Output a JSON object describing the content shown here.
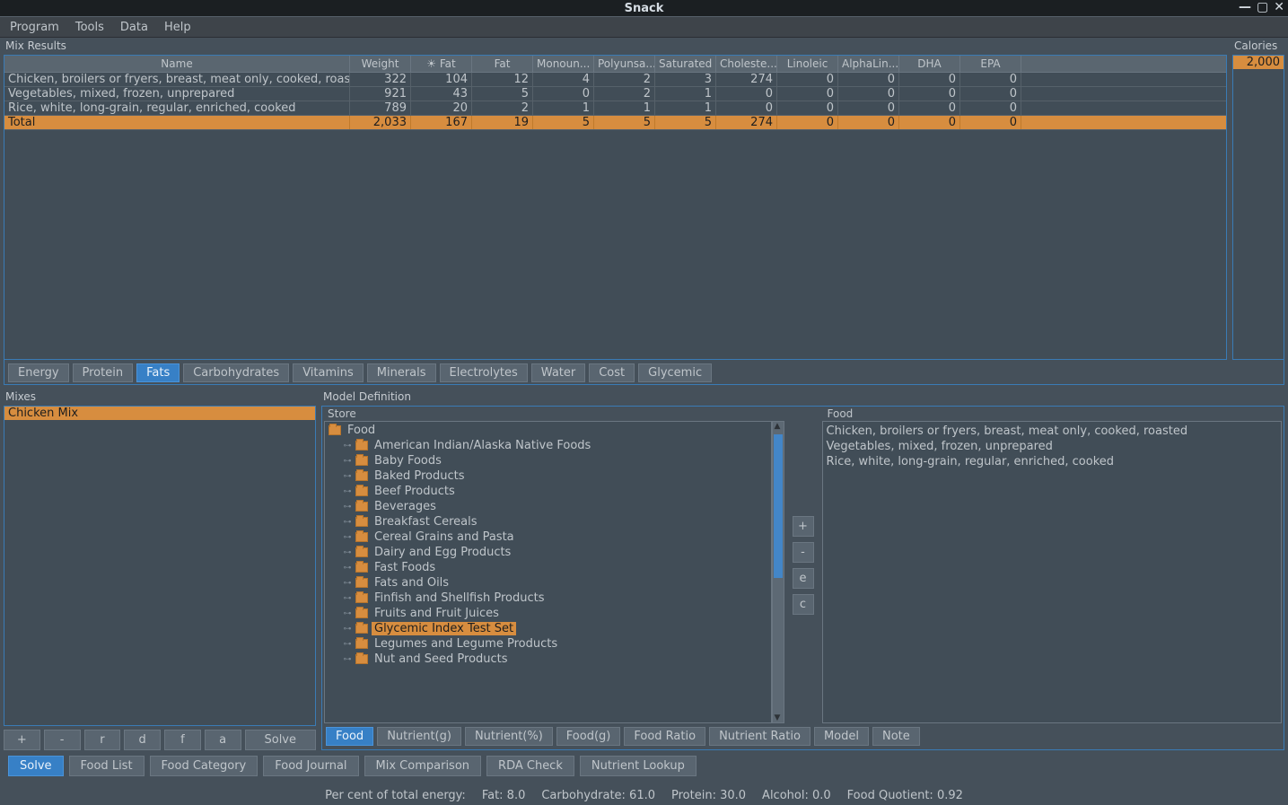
{
  "window": {
    "title": "Snack"
  },
  "menubar": [
    "Program",
    "Tools",
    "Data",
    "Help"
  ],
  "mix_results": {
    "label": "Mix Results",
    "columns": [
      "Name",
      "Weight",
      "☀ Fat",
      "Fat",
      "Monoun...",
      "Polyunsa...",
      "Saturated",
      "Choleste...",
      "Linoleic",
      "AlphaLin...",
      "DHA",
      "EPA"
    ],
    "rows": [
      {
        "name": "Chicken, broilers or fryers, breast, meat only, cooked, roasted",
        "vals": [
          "322",
          "104",
          "12",
          "4",
          "2",
          "3",
          "274",
          "0",
          "0",
          "0",
          "0"
        ]
      },
      {
        "name": "Vegetables, mixed, frozen, unprepared",
        "vals": [
          "921",
          "43",
          "5",
          "0",
          "2",
          "1",
          "0",
          "0",
          "0",
          "0",
          "0"
        ]
      },
      {
        "name": "Rice, white, long-grain, regular, enriched, cooked",
        "vals": [
          "789",
          "20",
          "2",
          "1",
          "1",
          "1",
          "0",
          "0",
          "0",
          "0",
          "0"
        ]
      }
    ],
    "total": {
      "name": "Total",
      "vals": [
        "2,033",
        "167",
        "19",
        "5",
        "5",
        "5",
        "274",
        "0",
        "0",
        "0",
        "0"
      ]
    }
  },
  "calories": {
    "label": "Calories",
    "value": "2,000"
  },
  "nutrient_tabs": {
    "items": [
      "Energy",
      "Protein",
      "Fats",
      "Carbohydrates",
      "Vitamins",
      "Minerals",
      "Electrolytes",
      "Water",
      "Cost",
      "Glycemic"
    ],
    "active": "Fats"
  },
  "mixes": {
    "label": "Mixes",
    "items": [
      "Chicken Mix"
    ],
    "selected": "Chicken Mix",
    "buttons": [
      "+",
      "-",
      "r",
      "d",
      "f",
      "a",
      "Solve"
    ]
  },
  "model": {
    "label": "Model Definition",
    "store": {
      "label": "Store",
      "root": "Food",
      "children": [
        "American Indian/Alaska Native Foods",
        "Baby Foods",
        "Baked Products",
        "Beef Products",
        "Beverages",
        "Breakfast Cereals",
        "Cereal Grains and Pasta",
        "Dairy and Egg Products",
        "Fast Foods",
        "Fats and Oils",
        "Finfish and Shellfish Products",
        "Fruits and Fruit Juices",
        "Glycemic Index Test Set",
        "Legumes and Legume Products",
        "Nut and Seed Products"
      ],
      "selected": "Glycemic Index Test Set"
    },
    "mid_buttons": [
      "+",
      "-",
      "e",
      "c"
    ],
    "food": {
      "label": "Food",
      "items": [
        "Chicken, broilers or fryers, breast, meat only, cooked, roasted",
        "Vegetables, mixed, frozen, unprepared",
        "Rice, white, long-grain, regular, enriched, cooked"
      ]
    },
    "tabs": {
      "items": [
        "Food",
        "Nutrient(g)",
        "Nutrient(%)",
        "Food(g)",
        "Food Ratio",
        "Nutrient Ratio",
        "Model",
        "Note"
      ],
      "active": "Food"
    }
  },
  "bottom_tabs": {
    "items": [
      "Solve",
      "Food List",
      "Food Category",
      "Food Journal",
      "Mix Comparison",
      "RDA Check",
      "Nutrient Lookup"
    ],
    "active": "Solve"
  },
  "status": {
    "label": "Per cent of total energy:",
    "parts": [
      "Fat: 8.0",
      "Carbohydrate: 61.0",
      "Protein: 30.0",
      "Alcohol: 0.0",
      "Food Quotient: 0.92"
    ]
  }
}
